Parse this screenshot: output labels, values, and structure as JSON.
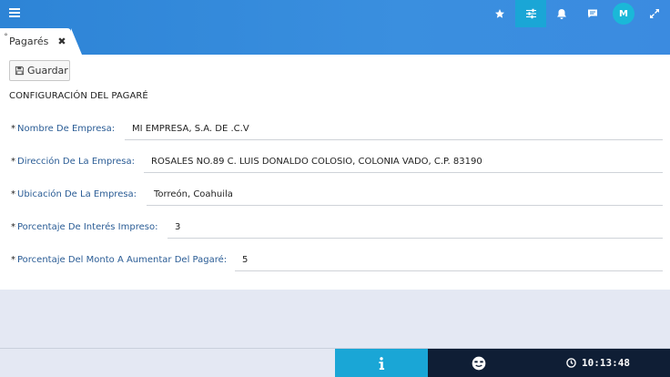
{
  "header": {
    "icons": [
      "menu-icon",
      "star-icon",
      "sliders-icon",
      "bell-icon",
      "chat-icon",
      "expand-icon"
    ],
    "avatar_initial": "M",
    "accent": "#2d84d6",
    "active_icon_bg": "#1aa6d6"
  },
  "tab": {
    "label": "Pagarés",
    "close": "✖"
  },
  "toolbar": {
    "save_label": "Guardar"
  },
  "form": {
    "title": "CONFIGURACIÓN DEL PAGARÉ",
    "required_mark": "*",
    "fields": [
      {
        "label": "Nombre De Empresa:",
        "value": "MI EMPRESA, S.A. DE .C.V"
      },
      {
        "label": "Dirección De La Empresa:",
        "value": "ROSALES NO.89 C. LUIS DONALDO COLOSIO, COLONIA VADO, C.P. 83190"
      },
      {
        "label": "Ubicación De La Empresa:",
        "value": "Torreón, Coahuila"
      },
      {
        "label": "Porcentaje De Interés Impreso:",
        "value": "3"
      },
      {
        "label": "Porcentaje Del Monto A Aumentar Del Pagaré:",
        "value": "5"
      }
    ]
  },
  "footer": {
    "time": "10:13:48",
    "info_bg": "#1aa6d6",
    "dark_bg": "#0f1e35"
  }
}
